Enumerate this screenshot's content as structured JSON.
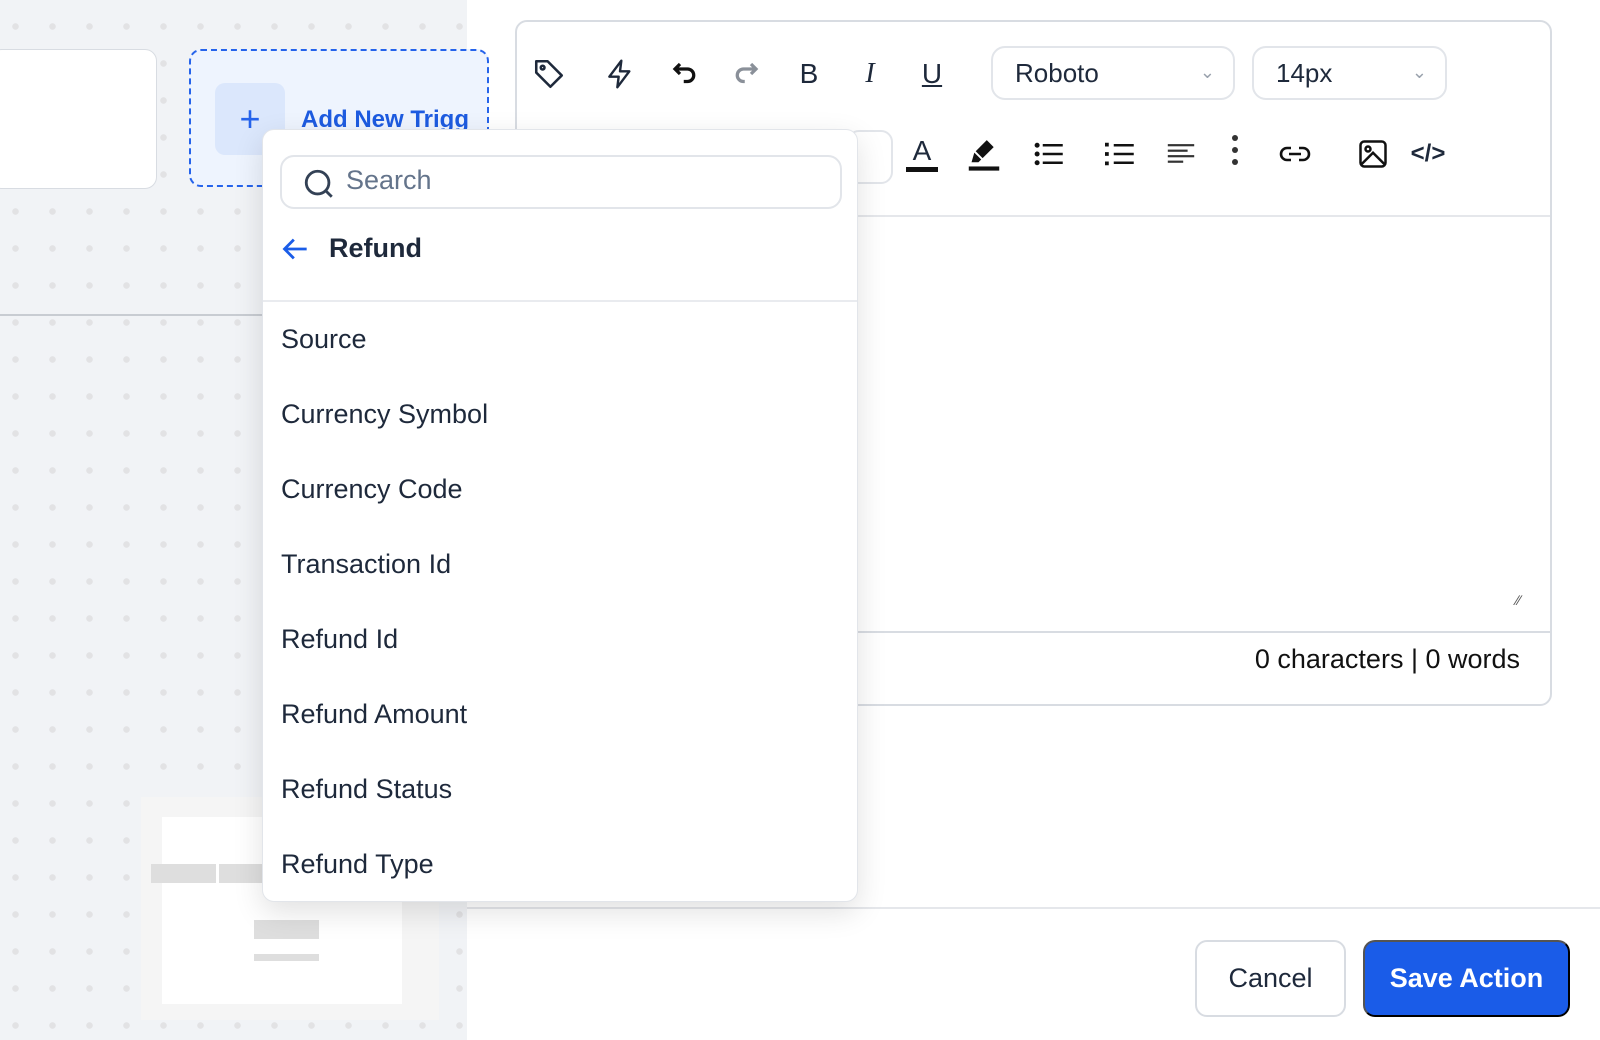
{
  "canvas": {
    "add_trigger_label": "Add New Trigg",
    "plus": "+"
  },
  "toolbar": {
    "icons": [
      "tag-icon",
      "lightning-icon",
      "undo-icon",
      "redo-icon",
      "bold-icon",
      "italic-icon",
      "underline-icon",
      "text-color-icon",
      "highlight-icon",
      "bullet-list-icon",
      "numbered-list-icon",
      "align-left-icon",
      "more-vertical-icon",
      "link-icon",
      "image-icon",
      "code-icon"
    ],
    "bold": "B",
    "italic": "I",
    "underline": "U",
    "text_color": "A",
    "font_family": "Roboto",
    "font_size": "14px"
  },
  "editor": {
    "counts": "0 characters | 0 words"
  },
  "dropdown": {
    "search_placeholder": "Search",
    "back_label": "Refund",
    "items": [
      "Source",
      "Currency Symbol",
      "Currency Code",
      "Transaction Id",
      "Refund Id",
      "Refund Amount",
      "Refund Status",
      "Refund Type"
    ]
  },
  "actions": {
    "cancel": "Cancel",
    "save": "Save Action"
  },
  "colors": {
    "primary": "#1a5ce8",
    "text": "#1e293b"
  }
}
